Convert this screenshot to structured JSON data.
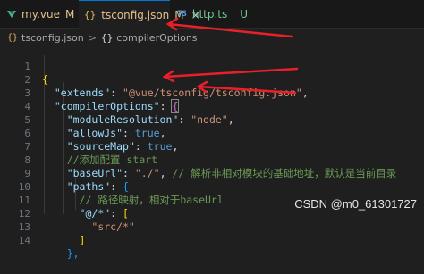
{
  "tabs": [
    {
      "name": "my.vue",
      "badge": "M",
      "icon": "vue-icon",
      "badge_color": "#e2c08d",
      "name_color": "#e2c08d"
    },
    {
      "name": "tsconfig.json",
      "badge": "M",
      "icon": "json-icon",
      "close": "×",
      "badge_color": "#e2c08d",
      "name_color": "#e2c08d"
    },
    {
      "name": "http.ts",
      "badge": "U",
      "icon": "ts-icon",
      "badge_color": "#73c991",
      "name_color": "#73c991"
    }
  ],
  "icons": {
    "ts_label": "TS",
    "json_label": "{}"
  },
  "breadcrumb": {
    "file": "tsconfig.json",
    "separator": ">",
    "braces": "{}",
    "symbol": "compilerOptions"
  },
  "code": {
    "l1": "{",
    "l2_key": "\"extends\"",
    "l2_val": "\"@vue/tsconfig/tsconfig.json\"",
    "l3_key": "\"compilerOptions\"",
    "l3_brace": "{",
    "l4_key": "\"moduleResolution\"",
    "l4_val": "\"node\"",
    "l5_key": "\"allowJs\"",
    "l5_val": "true",
    "l6_key": "\"sourceMap\"",
    "l6_val": "true",
    "l7_cmt": "//添加配置 start",
    "l8_key": "\"baseUrl\"",
    "l8_val": "\"./\"",
    "l8_cmt": "// 解析非相对模块的基础地址，默认是当前目录",
    "l9_key": "\"paths\"",
    "l9_brace": "{",
    "l10_cmt": "// 路径映射，相对于baseUrl",
    "l11_key": "\"@/*\"",
    "l11_brace": "[",
    "l12_val": "\"src/*\"",
    "l13": "]",
    "l14": "},"
  },
  "line_numbers": [
    "1",
    "2",
    "3",
    "4",
    "5",
    "6",
    "7",
    "8",
    "9",
    "10",
    "11",
    "12",
    "13",
    "14"
  ],
  "watermark": "CSDN @m0_61301727",
  "colors": {
    "accent": "#0078d4",
    "arrow": "#e8202a"
  }
}
